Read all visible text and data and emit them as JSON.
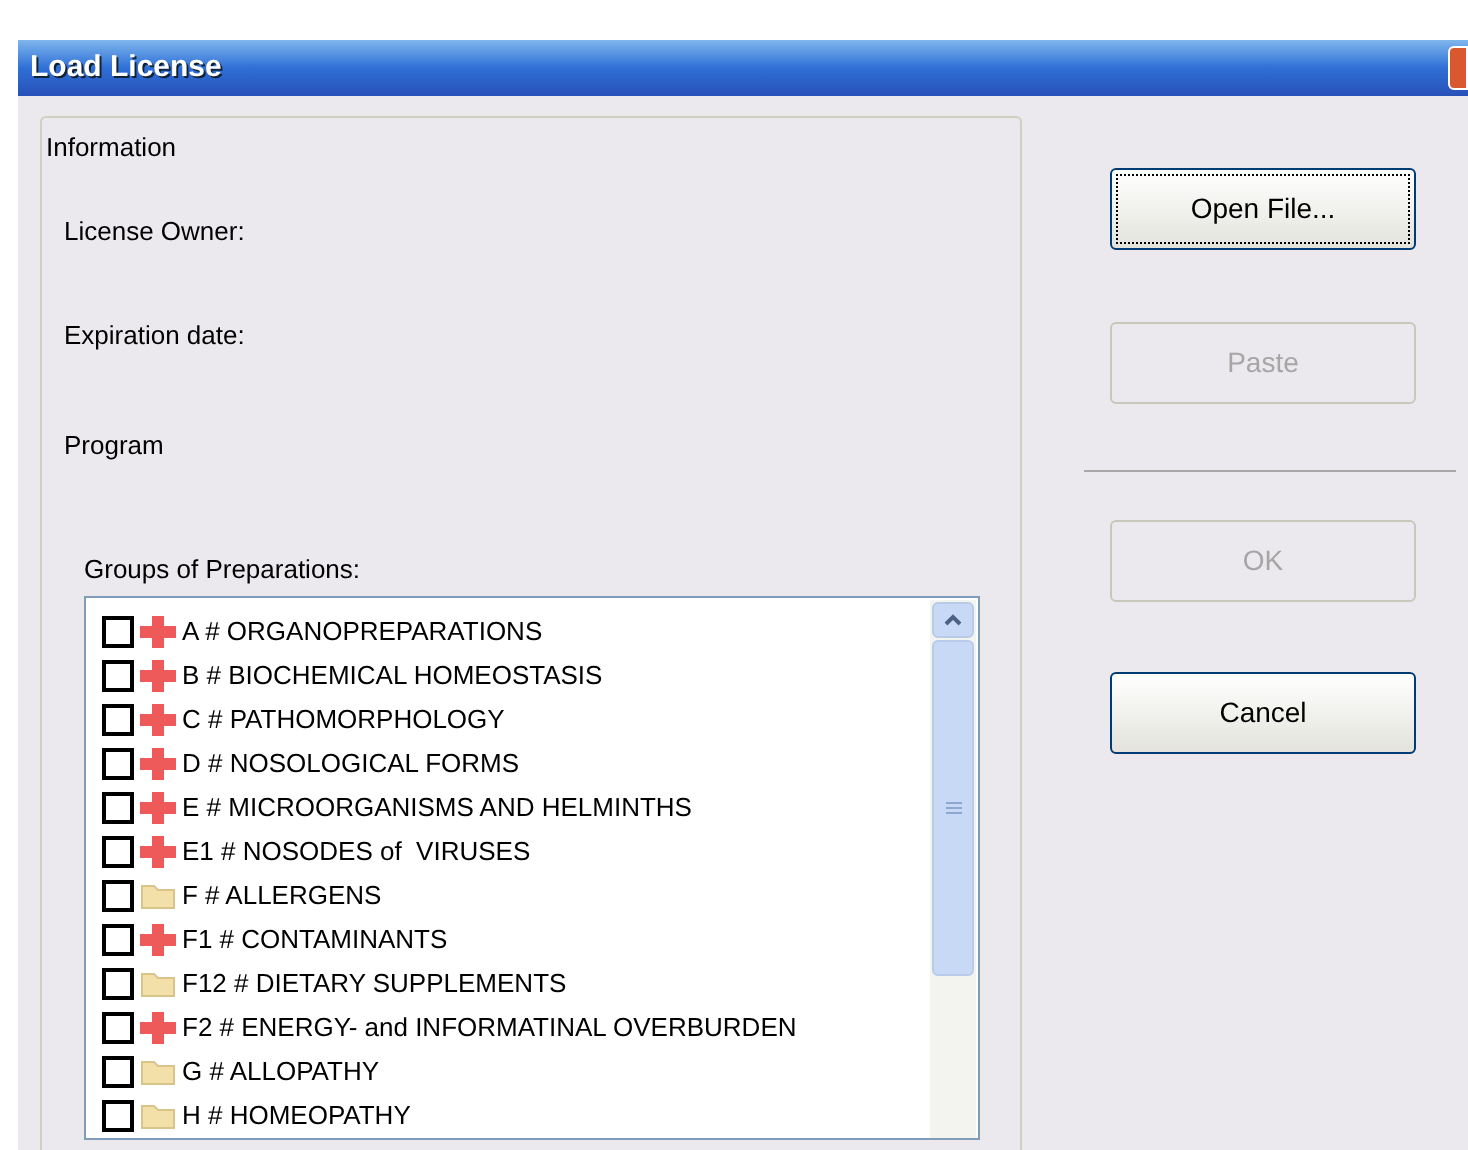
{
  "window": {
    "title": "Load License"
  },
  "information": {
    "title": "Information",
    "fields": [
      {
        "label": "License Owner:"
      },
      {
        "label": "Expiration date:"
      },
      {
        "label": "Program"
      }
    ]
  },
  "groups": {
    "label": "Groups of Preparations:",
    "items": [
      {
        "label": "A # ORGANOPREPARATIONS",
        "checked": false,
        "kind": "cross"
      },
      {
        "label": "B # BIOCHEMICAL HOMEOSTASIS",
        "checked": false,
        "kind": "cross"
      },
      {
        "label": "C # PATHOMORPHOLOGY",
        "checked": false,
        "kind": "cross"
      },
      {
        "label": "D # NOSOLOGICAL FORMS",
        "checked": false,
        "kind": "cross"
      },
      {
        "label": "E # MICROORGANISMS AND HELMINTHS",
        "checked": false,
        "kind": "cross"
      },
      {
        "label": "E1 # NOSODES of  VIRUSES",
        "checked": false,
        "kind": "cross"
      },
      {
        "label": "F # ALLERGENS",
        "checked": false,
        "kind": "folder"
      },
      {
        "label": "F1 # CONTAMINANTS",
        "checked": false,
        "kind": "cross"
      },
      {
        "label": "F12 # DIETARY SUPPLEMENTS",
        "checked": false,
        "kind": "folder"
      },
      {
        "label": "F2 # ENERGY- and INFORMATINAL OVERBURDEN",
        "checked": false,
        "kind": "cross"
      },
      {
        "label": "G # ALLOPATHY",
        "checked": false,
        "kind": "folder"
      },
      {
        "label": "H # HOMEOPATHY",
        "checked": false,
        "kind": "folder"
      }
    ]
  },
  "buttons": [
    {
      "label": "Open File...",
      "disabled": false,
      "focused": true
    },
    {
      "label": "Paste",
      "disabled": true,
      "focused": false
    },
    {
      "label": "OK",
      "disabled": true,
      "focused": false
    },
    {
      "label": "Cancel",
      "disabled": false,
      "focused": false
    }
  ]
}
